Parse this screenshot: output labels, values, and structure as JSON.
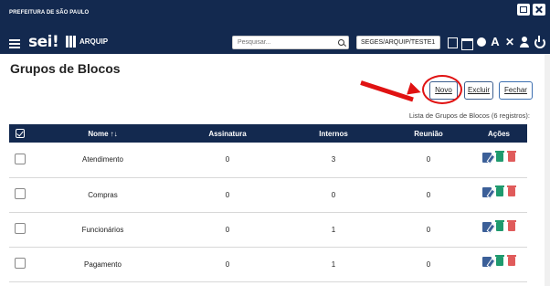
{
  "header": {
    "org_name": "PREFEITURA DE SÃO PAULO",
    "logo_text": "sei!",
    "product_name": "ARQUIP",
    "search_placeholder": "Pesquisar...",
    "unit_selector": "SEGES/ARQUIP/TESTE1"
  },
  "page": {
    "title": "Grupos de Blocos",
    "buttons": {
      "novo": "Novo",
      "excluir": "Excluir",
      "fechar": "Fechar"
    },
    "caption": "Lista de Grupos de Blocos (6 registros):"
  },
  "table": {
    "columns": [
      "Nome",
      "Assinatura",
      "Internos",
      "Reunião",
      "Ações"
    ],
    "rows": [
      {
        "nome": "Atendimento",
        "assinatura": "0",
        "internos": "3",
        "reuniao": "0"
      },
      {
        "nome": "Compras",
        "assinatura": "0",
        "internos": "0",
        "reuniao": "0"
      },
      {
        "nome": "Funcionários",
        "assinatura": "0",
        "internos": "1",
        "reuniao": "0"
      },
      {
        "nome": "Pagamento",
        "assinatura": "0",
        "internos": "1",
        "reuniao": "0"
      }
    ]
  },
  "colors": {
    "navbar": "#13294f",
    "link": "#2f6ebf",
    "annotation": "#e01212",
    "edit_icon": "#3b5f98",
    "green_icon": "#1f9a6e",
    "red_icon": "#e05b5b"
  }
}
